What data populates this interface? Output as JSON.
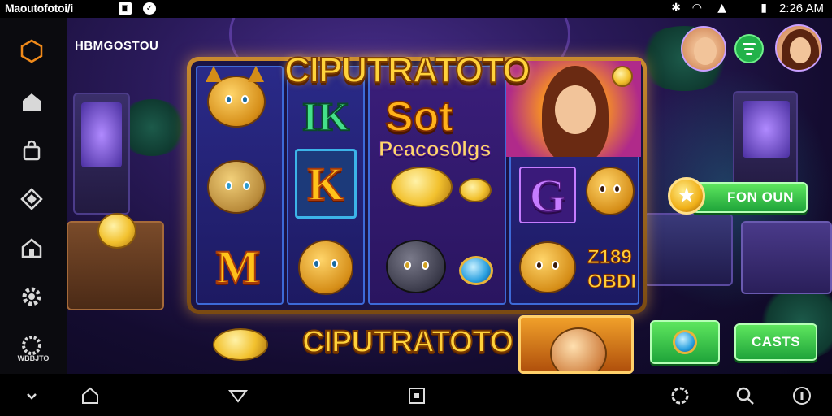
{
  "status_bar": {
    "app_title": "Maoutofotoi/i",
    "time": "2:26 AM",
    "icons": [
      "bluetooth-icon",
      "wifi-icon",
      "signal-icon",
      "battery-icon"
    ]
  },
  "side_rail": {
    "icons": [
      "hexagon-icon",
      "home-icon",
      "bag-icon",
      "diamond-icon",
      "house-gift-icon",
      "gear-icon",
      "spinner-icon",
      "chevron-down-icon"
    ],
    "bottom_label": "WBBJTO"
  },
  "game": {
    "top_left_label": "HBMGOSTOU",
    "title": "CIPUTRATOTO",
    "subtitle": "Sot",
    "reel_word": "Peacos0lgs",
    "ik_text": "IK",
    "letters": {
      "k": "K",
      "m": "M",
      "g": "G"
    },
    "paytable": {
      "line1": "Z189",
      "line2": "OBDI"
    },
    "bottom_banner": "CIPUTRATOTO",
    "fun_button": "FON OUN",
    "casts_button": "CASTS"
  },
  "nav_bar": {
    "icons": [
      "home-icon",
      "triangle-down-icon",
      "square-icon",
      "flower-icon",
      "search-icon",
      "info-icon"
    ]
  },
  "colors": {
    "gold": "#ffd23a",
    "button_green": "#1fa43a",
    "reel_blue": "#3d6ad8",
    "bg_purple": "#2a1a5a"
  }
}
